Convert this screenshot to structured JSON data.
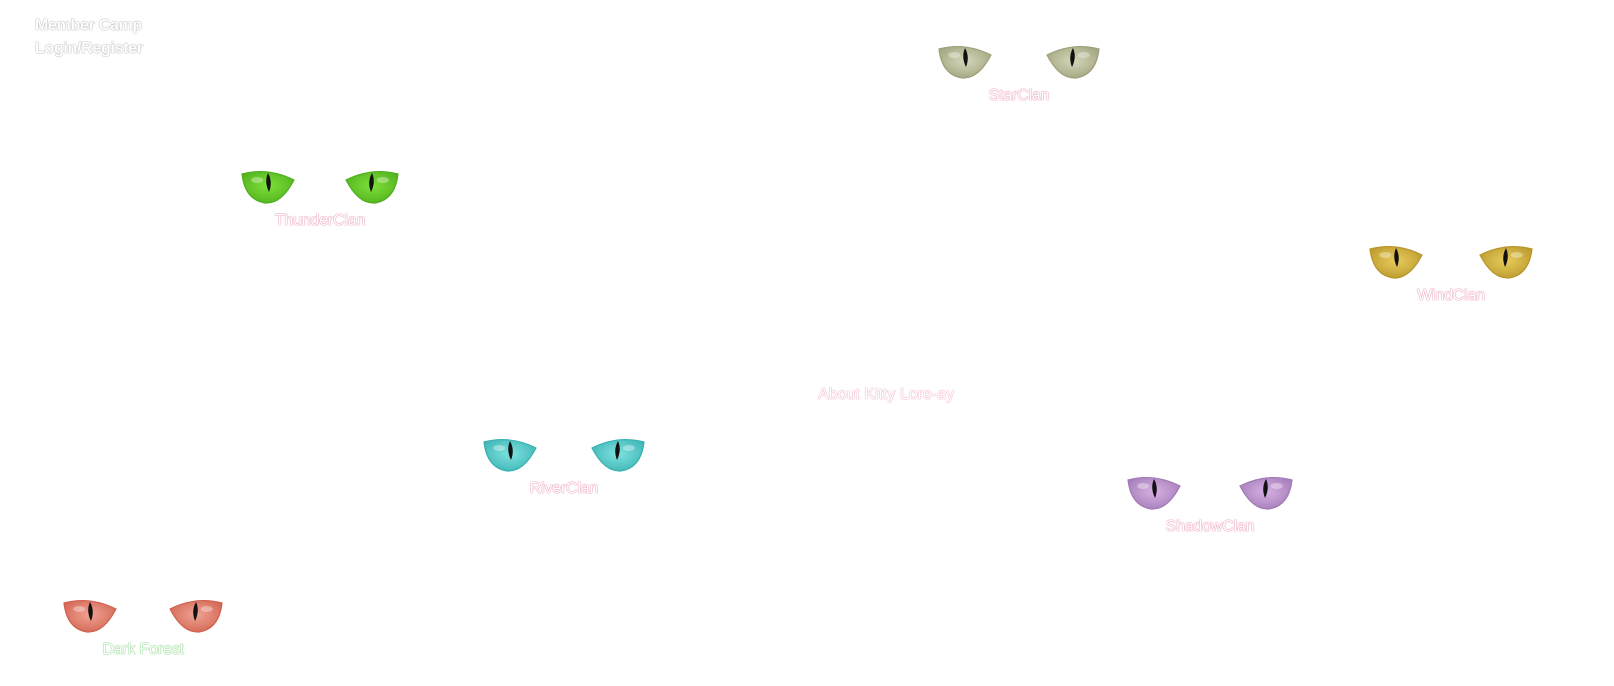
{
  "member_menu": {
    "camp": "Member Camp",
    "login": "Login/Register"
  },
  "about_link": "About Kitty Lore-ay",
  "clans": [
    {
      "id": "thunderclan",
      "label": "ThunderClan",
      "eye_color": "#7ee03a",
      "rim_color": "#4fae1c",
      "label_glow": "#e68aa6"
    },
    {
      "id": "starclan",
      "label": "StarClan",
      "eye_color": "#d6d7ba",
      "rim_color": "#9ea07a",
      "label_glow": "#e68aa6"
    },
    {
      "id": "windclan",
      "label": "WindClan",
      "eye_color": "#e9cc5d",
      "rim_color": "#b7962a",
      "label_glow": "#e68aa6"
    },
    {
      "id": "riverclan",
      "label": "RiverClan",
      "eye_color": "#7fe3e0",
      "rim_color": "#3ab1b2",
      "label_glow": "#e68aa6"
    },
    {
      "id": "shadowclan",
      "label": "ShadowClan",
      "eye_color": "#d8b0e3",
      "rim_color": "#a07ab6",
      "label_glow": "#e68aa6"
    },
    {
      "id": "darkforest",
      "label": "Dark Forest",
      "eye_color": "#f0a393",
      "rim_color": "#d1614f",
      "label_glow": "#7ccf7c"
    }
  ]
}
